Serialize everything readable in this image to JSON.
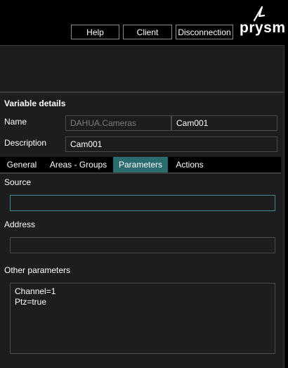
{
  "header": {
    "buttons": {
      "help": "Help",
      "client": "Client",
      "disconnection": "Disconnection"
    },
    "logo": {
      "text": "prysm",
      "icon": "prysm-logo-icon"
    }
  },
  "details": {
    "title": "Variable details",
    "name_label": "Name",
    "name_prefix": "DAHUA.Cameras",
    "name_value": "Cam001",
    "description_label": "Description",
    "description_value": "Cam001",
    "tabs": [
      {
        "label": "General",
        "active": false
      },
      {
        "label": "Areas - Groups",
        "active": false
      },
      {
        "label": "Parameters",
        "active": true
      },
      {
        "label": "Actions",
        "active": false
      }
    ]
  },
  "parameters": {
    "source_label": "Source",
    "source_value": "",
    "address_label": "Address",
    "address_value": "",
    "other_label": "Other parameters",
    "other_value": "Channel=1\nPtz=true"
  },
  "colors": {
    "accent": "#2a6b70",
    "focus_border": "#3f8c93",
    "panel": "#1d1d1d"
  }
}
